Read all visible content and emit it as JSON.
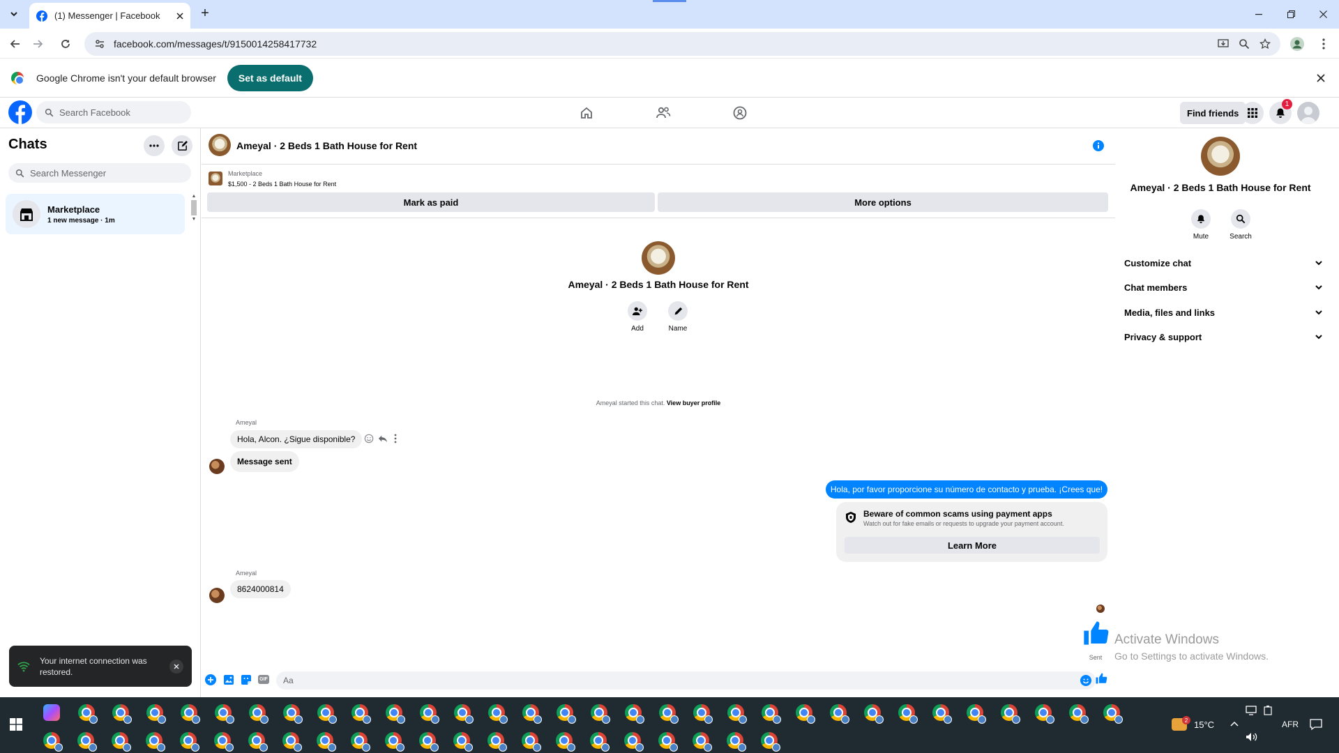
{
  "browser": {
    "tab_title": "(1) Messenger | Facebook",
    "url": "facebook.com/messages/t/9150014258417732",
    "infobar_text": "Google Chrome isn't your default browser",
    "set_default_label": "Set as default"
  },
  "fb_header": {
    "search_placeholder": "Search Facebook",
    "find_friends_label": "Find friends",
    "notification_count": "1"
  },
  "left_panel": {
    "title": "Chats",
    "search_placeholder": "Search Messenger",
    "chat_item": {
      "name": "Marketplace",
      "preview": "1 new message · 1m"
    }
  },
  "conversation": {
    "header_title": "Ameyal · 2 Beds 1 Bath House for Rent",
    "listing": {
      "source": "Marketplace",
      "detail": "$1,500 - 2 Beds 1 Bath House for Rent"
    },
    "mark_paid_label": "Mark as paid",
    "more_options_label": "More options",
    "intro_title": "Ameyal · 2 Beds 1 Bath House for Rent",
    "add_label": "Add",
    "name_label": "Name",
    "started_text": "Ameyal started this chat.",
    "view_buyer_label": "View buyer profile",
    "sender_name_1": "Ameyal",
    "incoming_1": "Hola, Alcon. ¿Sigue disponible?",
    "incoming_2": "Message sent",
    "outgoing_1": "Hola, por favor proporcione su número de contacto y prueba. ¡Crees que!",
    "scam_title": "Beware of common scams using payment apps",
    "scam_body": "Watch out for fake emails or requests to upgrade your payment account.",
    "learn_more_label": "Learn More",
    "sender_name_2": "Ameyal",
    "incoming_3": "8624000814",
    "sent_status": "Sent",
    "composer_placeholder": "Aa"
  },
  "right_panel": {
    "title": "Ameyal · 2 Beds 1 Bath House for Rent",
    "mute_label": "Mute",
    "search_label": "Search",
    "sections": [
      "Customize chat",
      "Chat members",
      "Media, files and links",
      "Privacy & support"
    ]
  },
  "toast": {
    "text": "Your internet connection was restored."
  },
  "watermark": {
    "line1": "Activate Windows",
    "line2": "Go to Settings to activate Windows."
  },
  "taskbar": {
    "temperature": "15°C",
    "weather_badge": "2",
    "language": "AFR"
  },
  "colors": {
    "fb_blue": "#0866ff",
    "messenger_blue": "#0084ff",
    "teal": "#0b6e6e"
  }
}
